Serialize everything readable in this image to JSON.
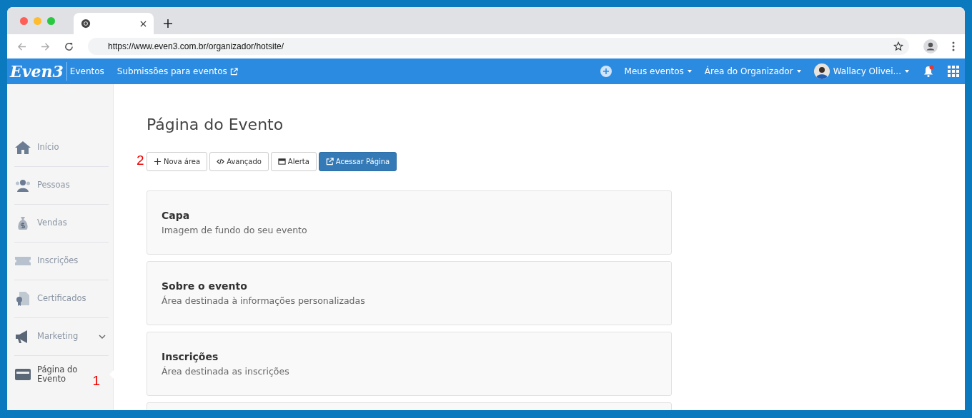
{
  "browser": {
    "url": "https://www.even3.com.br/organizador/hotsite/"
  },
  "header": {
    "logo": "Even3",
    "section": "Eventos",
    "link": "Submissões para eventos",
    "menus": [
      "Meus eventos",
      "Área do Organizador"
    ],
    "user": "Wallacy Olivei...",
    "notification": true
  },
  "sidebar": {
    "items": [
      {
        "label": "Início",
        "kind": "home",
        "selected": false
      },
      {
        "label": "Pessoas",
        "kind": "people",
        "selected": false
      },
      {
        "label": "Vendas",
        "kind": "money",
        "selected": false
      },
      {
        "label": "Inscrições",
        "kind": "ticket",
        "selected": false
      },
      {
        "label": "Certificados",
        "kind": "certificate",
        "selected": false
      },
      {
        "label": "Marketing",
        "kind": "megaphone",
        "selected": false,
        "expandable": true
      },
      {
        "label": "Página do Evento",
        "kind": "page",
        "selected": true
      }
    ]
  },
  "page": {
    "title": "Página do Evento",
    "buttons": [
      {
        "label": "Nova área",
        "kind": "plus",
        "primary": false
      },
      {
        "label": "Avançado",
        "kind": "code",
        "primary": false
      },
      {
        "label": "Alerta",
        "kind": "window",
        "primary": false
      },
      {
        "label": "Acessar Página",
        "kind": "external",
        "primary": true
      }
    ],
    "sections": [
      {
        "title": "Capa",
        "description": "Imagem de fundo do seu evento"
      },
      {
        "title": "Sobre o evento",
        "description": "Área destinada à informações personalizadas"
      },
      {
        "title": "Inscrições",
        "description": "Área destinada as inscrições"
      }
    ]
  },
  "annotations": [
    "1",
    "2"
  ]
}
